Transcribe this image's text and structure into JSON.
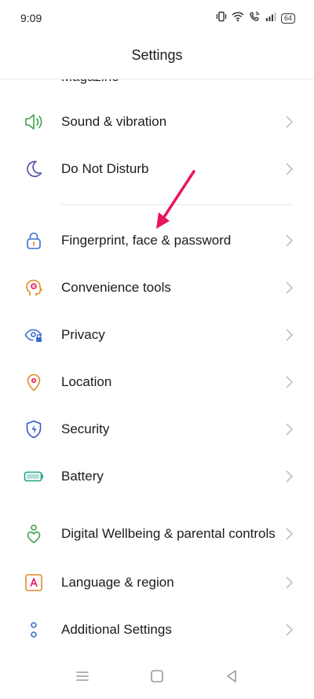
{
  "status_bar": {
    "time": "9:09",
    "battery": "64",
    "icons": [
      "vibrate-icon",
      "wifi-icon",
      "wifi-calling-icon",
      "signal-icon",
      "battery-icon"
    ]
  },
  "header": {
    "title": "Settings"
  },
  "partial_item": {
    "label": "Magazine"
  },
  "items": [
    {
      "label": "Sound & vibration",
      "icon": "speaker-icon",
      "color": "#3fa14d"
    },
    {
      "label": "Do Not Disturb",
      "icon": "moon-icon",
      "color": "#4b4aa6"
    },
    {
      "label": "Fingerprint, face & password",
      "icon": "lock-icon",
      "color": "#3a6fd0"
    },
    {
      "label": "Convenience tools",
      "icon": "head-gear-icon",
      "color": "#e28a1d"
    },
    {
      "label": "Privacy",
      "icon": "eye-lock-icon",
      "color": "#3a6fd0"
    },
    {
      "label": "Location",
      "icon": "location-pin-icon",
      "color": "#e08a2a"
    },
    {
      "label": "Security",
      "icon": "shield-bolt-icon",
      "color": "#3a55c8"
    },
    {
      "label": "Battery",
      "icon": "battery-icon",
      "color": "#1fa389"
    },
    {
      "label": "Digital Wellbeing & parental controls",
      "icon": "wellbeing-heart-icon",
      "color": "#3fa14d"
    },
    {
      "label": "Language & region",
      "icon": "letter-a-icon",
      "color": "#e08a2a"
    },
    {
      "label": "Additional Settings",
      "icon": "two-dots-icon",
      "color": "#3a6fd0"
    }
  ],
  "annotation": {
    "arrow_color": "#e8155a"
  },
  "nav_bar": {
    "icons": [
      "menu-icon",
      "home-icon",
      "back-icon"
    ]
  }
}
